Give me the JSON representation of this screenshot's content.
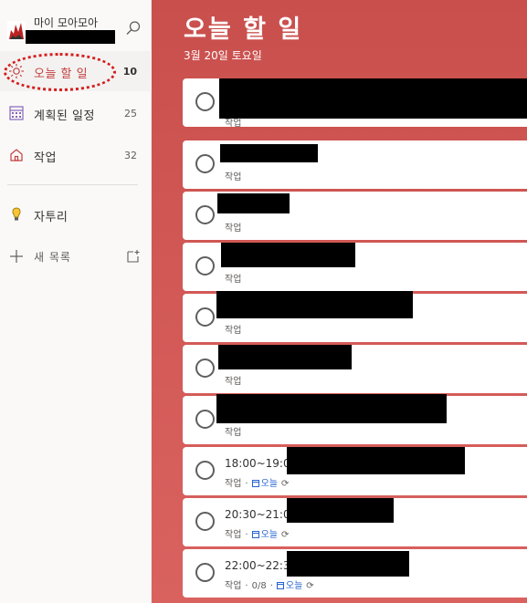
{
  "sidebar": {
    "profile_name": "마이 모아모아",
    "nav": [
      {
        "label": "오늘 할 일",
        "count": "10"
      },
      {
        "label": "계획된 일정",
        "count": "25"
      },
      {
        "label": "작업",
        "count": "32"
      }
    ],
    "lists": [
      {
        "label": "자투리"
      }
    ],
    "new_list_label": "새 목록"
  },
  "main": {
    "title": "오늘 할 일",
    "date": "3월 20일 토요일",
    "tasks": [
      {
        "title": "",
        "list": "작업"
      },
      {
        "title": "",
        "list": "작업"
      },
      {
        "title": "",
        "list": "작업"
      },
      {
        "title": "",
        "list": "작업"
      },
      {
        "title": "",
        "list": "작업"
      },
      {
        "title": "",
        "list": "작업"
      },
      {
        "title": "",
        "list": "작업"
      },
      {
        "title": "18:00~19:00",
        "list": "작업",
        "due": "오늘"
      },
      {
        "title": "20:30~21:00",
        "list": "작업",
        "due": "오늘"
      },
      {
        "title": "22:00~22:30",
        "list": "작업",
        "steps": "0/8",
        "due": "오늘"
      }
    ]
  },
  "colors": {
    "accent": "#c43e3e",
    "header_bg": "#c94f4d",
    "due_blue": "#2564cf"
  },
  "icons": {
    "search": "search-icon",
    "my_day": "sun-icon",
    "planned": "calendar-grid-icon",
    "tasks": "home-icon",
    "list": "lightbulb-icon",
    "new_list": "plus-icon",
    "new_group": "new-group-icon",
    "due": "calendar-icon",
    "repeat": "repeat-icon"
  }
}
